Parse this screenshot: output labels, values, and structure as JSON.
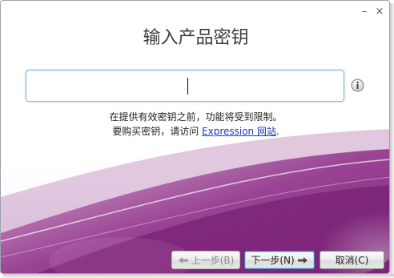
{
  "window": {
    "minimize_glyph": "–",
    "close_glyph": "×"
  },
  "title": "输入产品密钥",
  "product_key": {
    "value": ""
  },
  "info_icon": "info-icon",
  "notice": {
    "line1": "在提供有效密钥之前，功能将受到限制。",
    "line2_prefix": "要购买密钥，请访问 ",
    "link": "Expression 网站",
    "line2_suffix": "."
  },
  "buttons": {
    "back": "上一步(B)",
    "next": "下一步(N)",
    "cancel": "取消(C)"
  },
  "colors": {
    "accent_purple": "#8a2f86",
    "link": "#1a3bbf",
    "input_border": "#8fb6d8"
  }
}
